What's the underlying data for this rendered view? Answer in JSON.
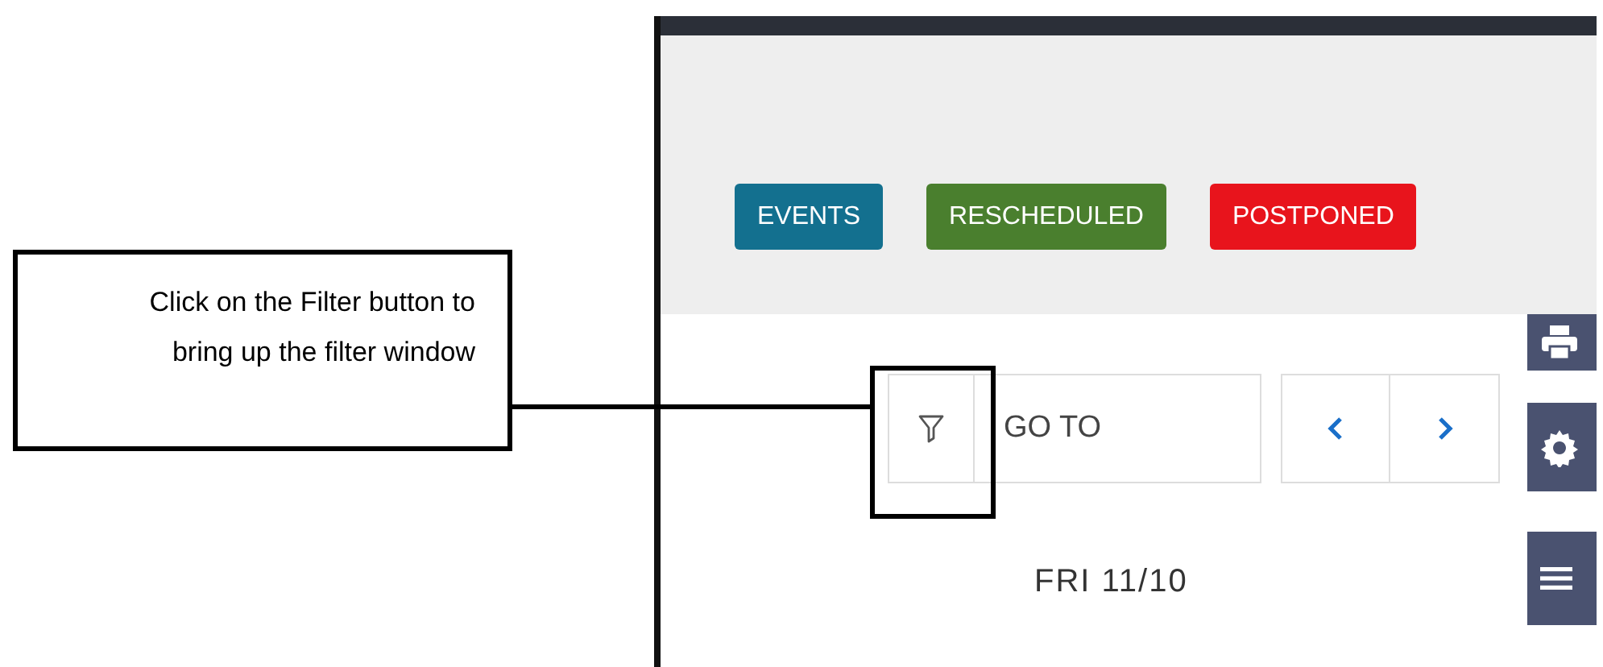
{
  "callout": {
    "text": "Click on the Filter button to bring up the filter window"
  },
  "legend": [
    {
      "label": "EVENTS",
      "color": "#13708f"
    },
    {
      "label": "RESCHEDULED",
      "color": "#4a7f2e"
    },
    {
      "label": "POSTPONED",
      "color": "#e8141c"
    }
  ],
  "toolbar": {
    "goto": {
      "placeholder": "GO TO"
    }
  },
  "date": "FRI 11/10"
}
